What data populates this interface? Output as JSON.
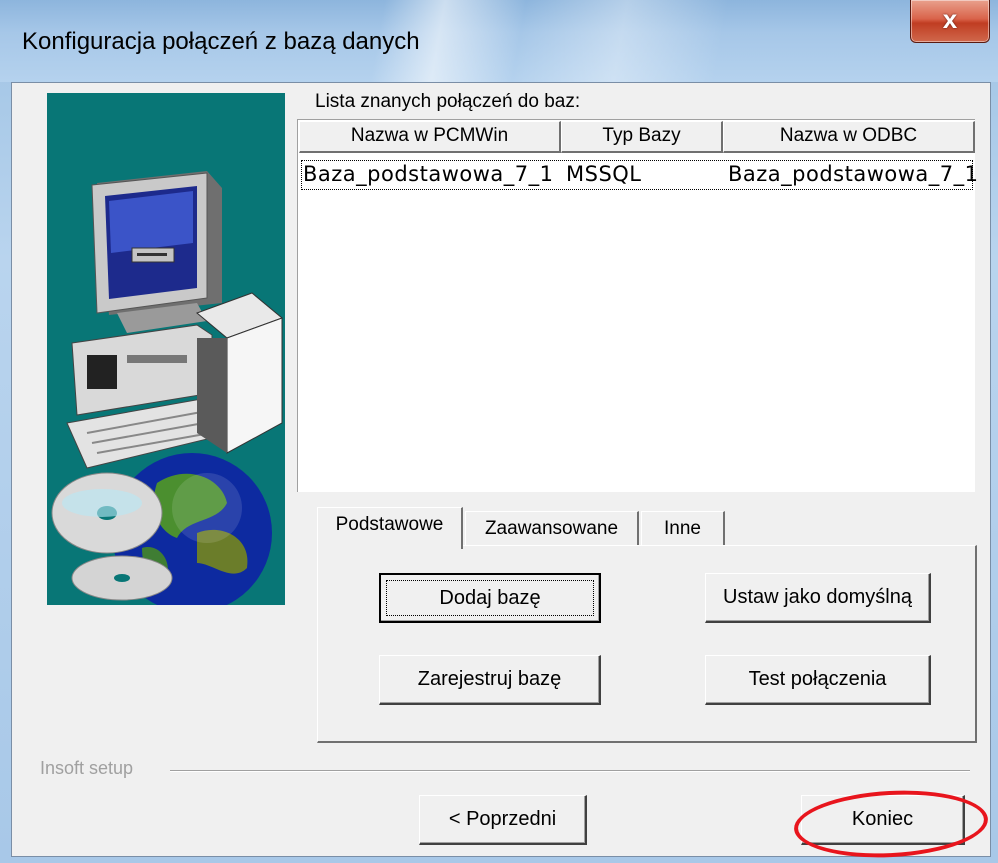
{
  "window": {
    "title": "Konfiguracja połączeń z bazą danych",
    "close_label": "x"
  },
  "list": {
    "label": "Lista znanych połączeń do baz:",
    "columns": [
      "Nazwa w PCMWin",
      "Typ Bazy",
      "Nazwa w ODBC"
    ],
    "rows": [
      [
        "Baza_podstawowa_7_1",
        "MSSQL",
        "Baza_podstawowa_7_1"
      ]
    ]
  },
  "tabs": [
    {
      "label": "Podstawowe"
    },
    {
      "label": "Zaawansowane"
    },
    {
      "label": "Inne"
    }
  ],
  "tab_buttons": {
    "add": "Dodaj bazę",
    "set_default": "Ustaw jako domyślną",
    "register": "Zarejestruj bazę",
    "test": "Test połączenia"
  },
  "group": {
    "label": "Insoft setup"
  },
  "nav": {
    "back": "< Poprzedni",
    "finish": "Koniec"
  },
  "colors": {
    "art_bg": "#087676",
    "annotation": "#e8151d",
    "dialog_bg": "#f0f0f0"
  },
  "icons": [
    "close-icon",
    "computer-illustration",
    "globe-illustration",
    "cd-illustration"
  ]
}
